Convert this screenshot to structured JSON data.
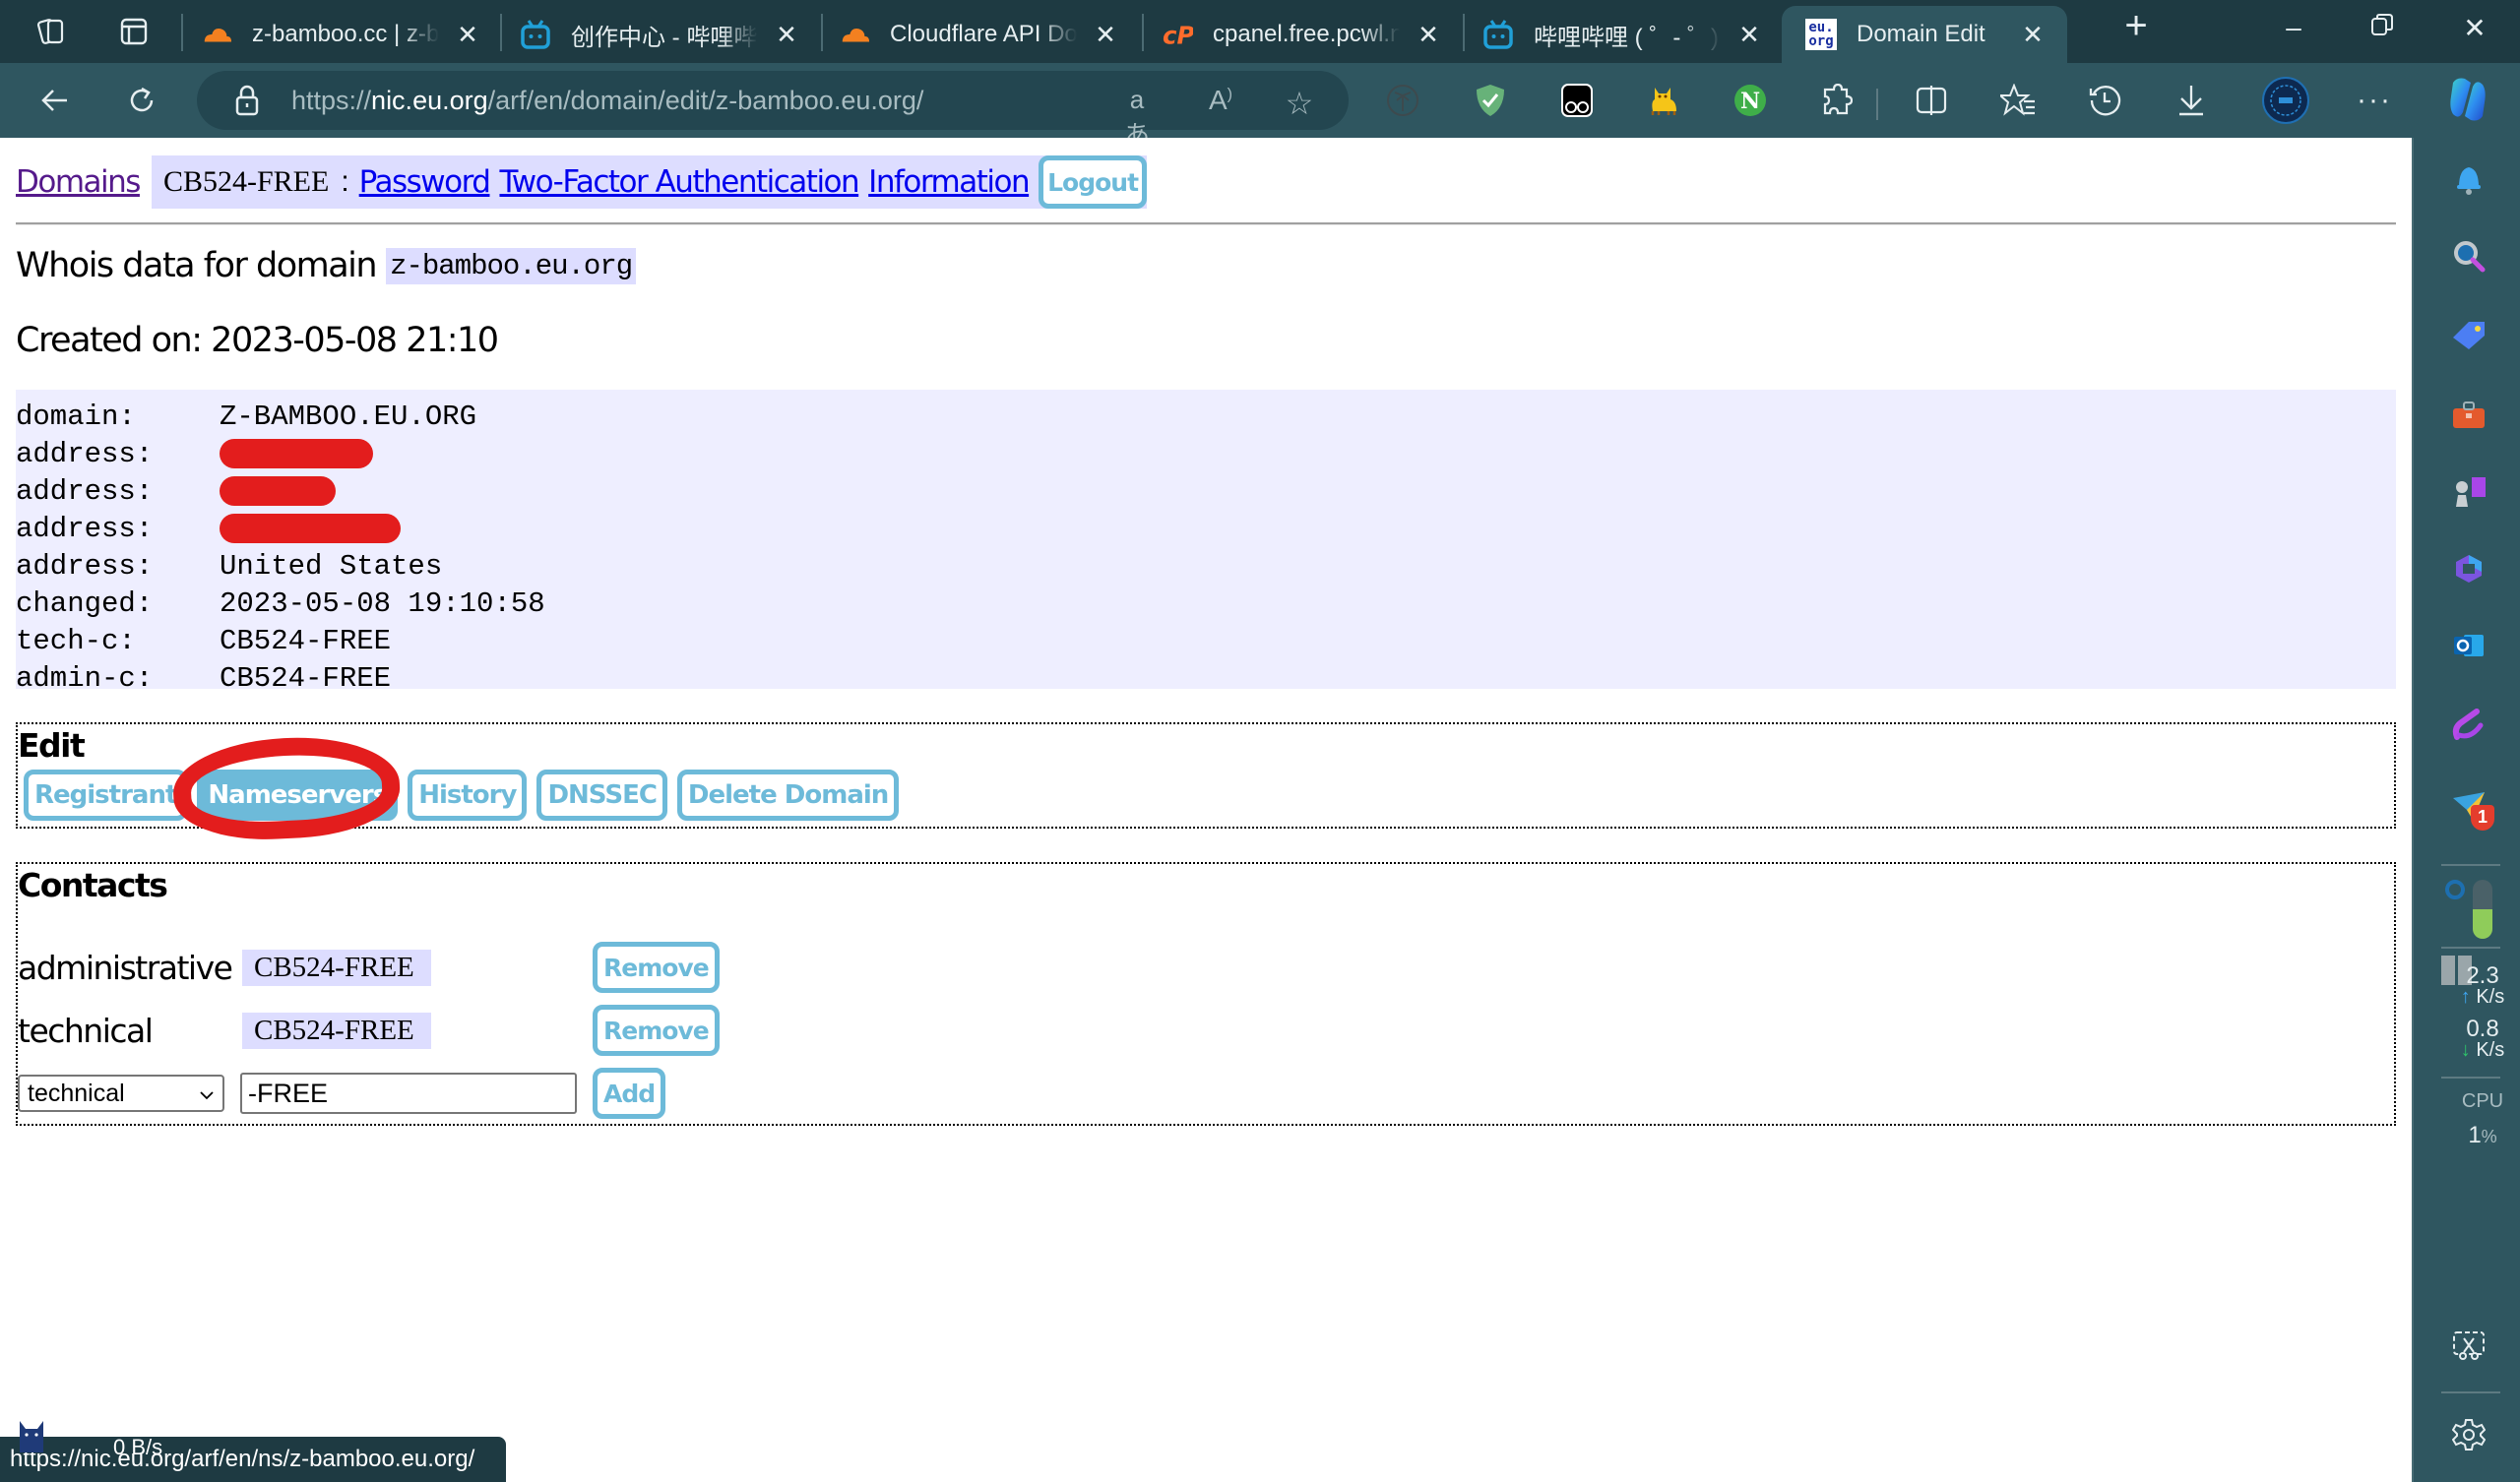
{
  "tabs": [
    {
      "title": "z-bamboo.cc | z-bamboo",
      "favicon": "cloudflare-icon",
      "active": false
    },
    {
      "title": "创作中心 - 哔哩哔哩",
      "favicon": "bilibili-icon",
      "active": false
    },
    {
      "title": "Cloudflare API Docs",
      "favicon": "cloudflare-icon",
      "active": false
    },
    {
      "title": "cpanel.free.pcwl.net",
      "favicon": "cpanel-icon",
      "active": false
    },
    {
      "title": "哔哩哔哩 ( ゜- ゜)つ",
      "favicon": "bilibili-icon",
      "active": false
    },
    {
      "title": "Domain Edit",
      "favicon": "eu-org-icon",
      "active": true
    }
  ],
  "favicon_text": {
    "eu_org_top": "eu.",
    "eu_org_bottom": "org"
  },
  "address_bar": {
    "url_prefix": "https://",
    "url_host": "nic.eu.org",
    "url_path": "/arf/en/domain/edit/z-bamboo.eu.org/"
  },
  "toolbar_glyphs": {
    "read_aloud": "A",
    "translate": "aあ",
    "more": "···"
  },
  "nav": {
    "domains": "Domains",
    "user_handle": "CB524-FREE",
    "separator": ":",
    "password": "Password",
    "two_factor": "Two-Factor Authentication",
    "information": "Information",
    "logout": "Logout"
  },
  "whois": {
    "title": "Whois data for domain",
    "domain": "z-bamboo.eu.org",
    "created_label": "Created on:",
    "created_value": "2023-05-08 21:10",
    "records": [
      {
        "key": "domain:",
        "value": "Z-BAMBOO.EU.ORG",
        "redacted": false
      },
      {
        "key": "address:",
        "value": "",
        "redacted": true
      },
      {
        "key": "address:",
        "value": "",
        "redacted": true
      },
      {
        "key": "address:",
        "value": "",
        "redacted": true
      },
      {
        "key": "address:",
        "value": "United States",
        "redacted": false
      },
      {
        "key": "changed:",
        "value": "2023-05-08 19:10:58",
        "redacted": false
      },
      {
        "key": "tech-c:",
        "value": "CB524-FREE",
        "redacted": false
      },
      {
        "key": "admin-c:",
        "value": "CB524-FREE",
        "redacted": false
      }
    ]
  },
  "edit": {
    "title": "Edit",
    "buttons": [
      "Registrant",
      "Nameservers",
      "History",
      "DNSSEC",
      "Delete Domain"
    ],
    "selected": "Nameservers"
  },
  "contacts": {
    "title": "Contacts",
    "rows": [
      {
        "role": "administrative",
        "handle": "CB524-FREE",
        "action": "Remove"
      },
      {
        "role": "technical",
        "handle": "CB524-FREE",
        "action": "Remove"
      }
    ],
    "add_form": {
      "type_selected": "technical",
      "handle_value": "-FREE",
      "action": "Add"
    }
  },
  "status_bar": {
    "hover_url": "https://nic.eu.org/arf/en/ns/z-bamboo.eu.org/",
    "net_speed": "0 B/s"
  },
  "sidebar_widget": {
    "upload_value": "2.3",
    "upload_unit": "K/s",
    "download_value": "0.8",
    "download_unit": "K/s",
    "cpu_label": "CPU",
    "cpu_value": "1",
    "cpu_unit": "%",
    "memory_usage": 0.5,
    "notification_badge": "1"
  },
  "colors": {
    "chrome_dark": "#1e3a42",
    "chrome": "#2f5660",
    "button_accent": "#6dbad9",
    "highlight_bg": "#ddddff",
    "whois_bg": "#eeeeff",
    "link": "#0000ee",
    "link_visited": "#551a8b",
    "annotation_red": "#e31d1d"
  }
}
